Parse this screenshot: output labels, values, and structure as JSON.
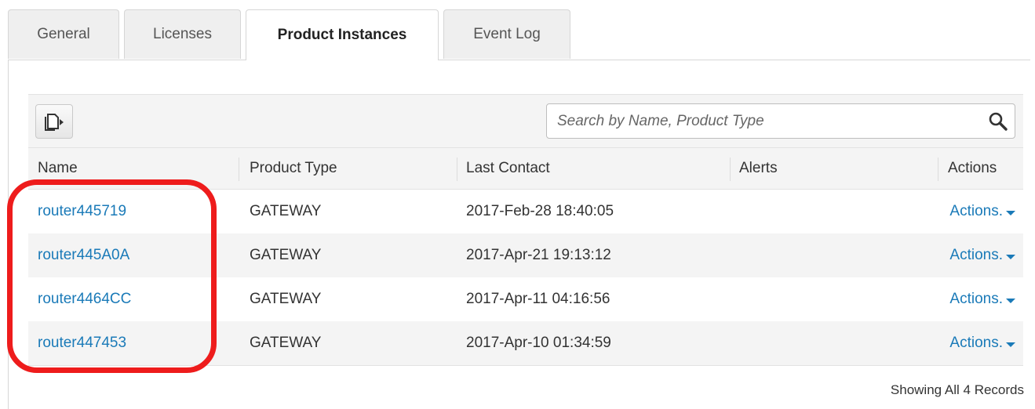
{
  "tabs": [
    {
      "label": "General"
    },
    {
      "label": "Licenses"
    },
    {
      "label": "Product Instances"
    },
    {
      "label": "Event Log"
    }
  ],
  "active_tab": "Product Instances",
  "search": {
    "placeholder": "Search by Name, Product Type",
    "value": ""
  },
  "table": {
    "columns": [
      "Name",
      "Product Type",
      "Last Contact",
      "Alerts",
      "Actions"
    ],
    "rows": [
      {
        "name": "router445719",
        "product_type": "GATEWAY",
        "last_contact": "2017-Feb-28 18:40:05",
        "alerts": "",
        "actions": "Actions."
      },
      {
        "name": "router445A0A",
        "product_type": "GATEWAY",
        "last_contact": "2017-Apr-21 19:13:12",
        "alerts": "",
        "actions": "Actions."
      },
      {
        "name": "router4464CC",
        "product_type": "GATEWAY",
        "last_contact": "2017-Apr-11 04:16:56",
        "alerts": "",
        "actions": "Actions."
      },
      {
        "name": "router447453",
        "product_type": "GATEWAY",
        "last_contact": "2017-Apr-10 01:34:59",
        "alerts": "",
        "actions": "Actions."
      }
    ]
  },
  "footer": {
    "records_text": "Showing All 4 Records"
  },
  "icons": {
    "export": "export-icon",
    "search": "search-icon",
    "actions_caret": "caret-down-icon"
  },
  "colors": {
    "link": "#1a7ab8",
    "highlight": "#ee1c1c",
    "header_bg": "#f4f4f4"
  }
}
